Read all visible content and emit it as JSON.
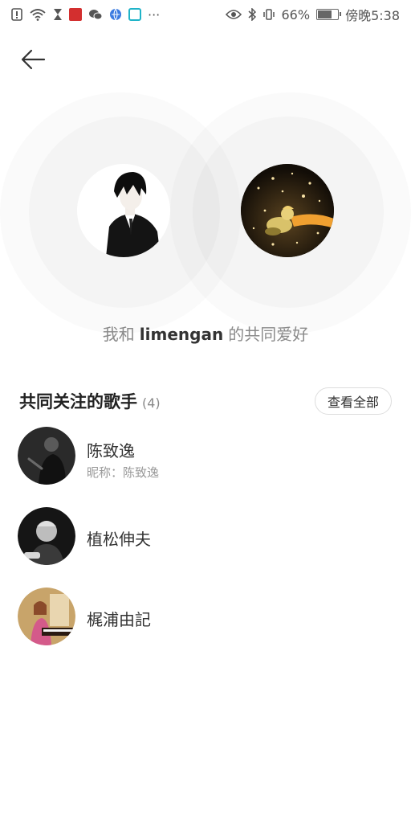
{
  "status_bar": {
    "battery_percent": "66%",
    "time": "傍晚5:38",
    "more": "···",
    "icons_left": [
      "alert-icon",
      "wifi-icon",
      "hourglass-icon",
      "app-red-icon",
      "wechat-icon",
      "browser-icon",
      "app-cyan-icon"
    ],
    "icons_right": [
      "eye-icon",
      "bluetooth-icon",
      "vibrate-icon",
      "battery-icon"
    ]
  },
  "header": {
    "back_icon": "arrow-left-icon"
  },
  "match": {
    "prefix": "我和",
    "friend_name": "limengan",
    "suffix": "的共同爱好"
  },
  "section": {
    "title": "共同关注的歌手",
    "count": "(4)",
    "view_all_label": "查看全部"
  },
  "artists": [
    {
      "name": "陈致逸",
      "nickname": "昵称：陈致逸"
    },
    {
      "name": "植松伸夫"
    },
    {
      "name": "梶浦由記"
    }
  ],
  "colors": {
    "text_primary": "#333333",
    "text_secondary": "#999999",
    "accent_orange": "#f0a030"
  }
}
